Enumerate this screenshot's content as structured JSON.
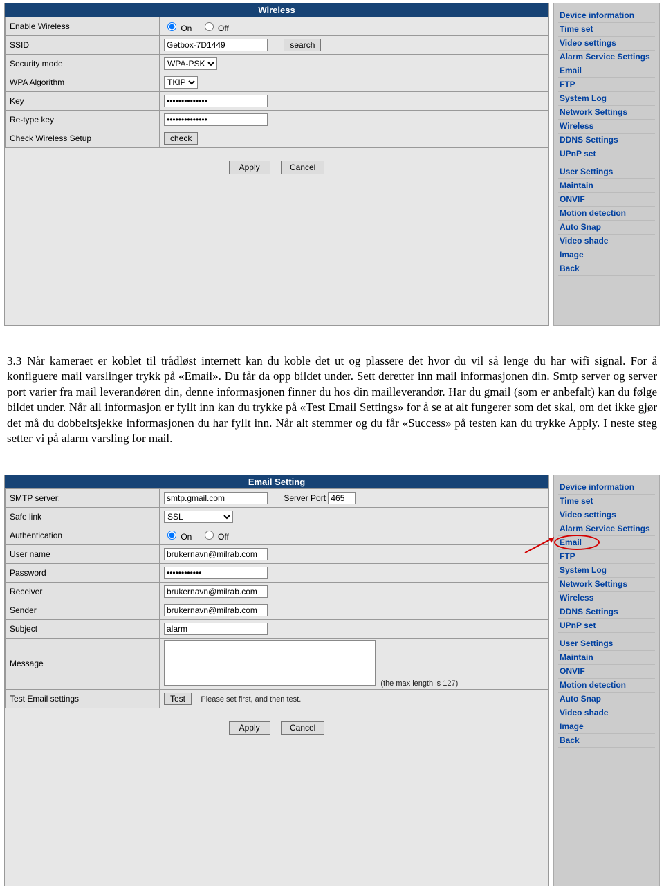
{
  "nav_items": [
    "Device information",
    "Time set",
    "Video settings",
    "Alarm Service Settings",
    "Email",
    "FTP",
    "System Log",
    "Network Settings",
    "Wireless",
    "DDNS Settings",
    "UPnP set",
    "",
    "User Settings",
    "Maintain",
    "ONVIF",
    "Motion detection",
    "Auto Snap",
    "Video shade",
    "Image",
    "Back"
  ],
  "wireless": {
    "title": "Wireless",
    "rows": {
      "enable_label": "Enable Wireless",
      "enable_on": "On",
      "enable_off": "Off",
      "ssid_label": "SSID",
      "ssid_value": "Getbox-7D1449",
      "search_btn": "search",
      "secmode_label": "Security mode",
      "secmode_value": "WPA-PSK",
      "algo_label": "WPA Algorithm",
      "algo_value": "TKIP",
      "key_label": "Key",
      "key_value": "••••••••••••••",
      "retype_label": "Re-type key",
      "retype_value": "••••••••••••••",
      "check_label": "Check Wireless Setup",
      "check_btn": "check"
    },
    "apply": "Apply",
    "cancel": "Cancel"
  },
  "doc": {
    "num": "3.3",
    "text": "Når kameraet er koblet til trådløst internett kan du koble det ut og plassere det hvor du vil så lenge du har wifi signal. For å konfiguere mail varslinger trykk på «Email». Du får da opp bildet under. Sett deretter inn mail informasjonen din. Smtp server og server port varier fra mail leverandøren din, denne informasjonen finner du hos din mailleverandør. Har du gmail (som er anbefalt) kan du følge bildet under. Når all informasjon er fyllt inn kan du trykke på «Test Email Settings» for å se at alt fungerer som det skal, om det ikke gjør det må du dobbeltsjekke informasjonen du har fyllt inn. Når alt stemmer og du får «Success» på testen kan du trykke Apply. I neste steg setter vi på alarm varsling for mail."
  },
  "email": {
    "title": "Email Setting",
    "rows": {
      "smtp_label": "SMTP server:",
      "smtp_value": "smtp.gmail.com",
      "port_label": "Server Port",
      "port_value": "465",
      "safelink_label": "Safe link",
      "safelink_value": "SSL",
      "auth_label": "Authentication",
      "auth_on": "On",
      "auth_off": "Off",
      "user_label": "User name",
      "user_value": "brukernavn@milrab.com",
      "pass_label": "Password",
      "pass_value": "••••••••••••",
      "receiver_label": "Receiver",
      "receiver_value": "brukernavn@milrab.com",
      "sender_label": "Sender",
      "sender_value": "brukernavn@milrab.com",
      "subject_label": "Subject",
      "subject_value": "alarm",
      "message_label": "Message",
      "message_hint": "(the max length is 127)",
      "test_label": "Test Email settings",
      "test_btn": "Test",
      "test_hint": "Please set first, and then test."
    },
    "apply": "Apply",
    "cancel": "Cancel"
  }
}
